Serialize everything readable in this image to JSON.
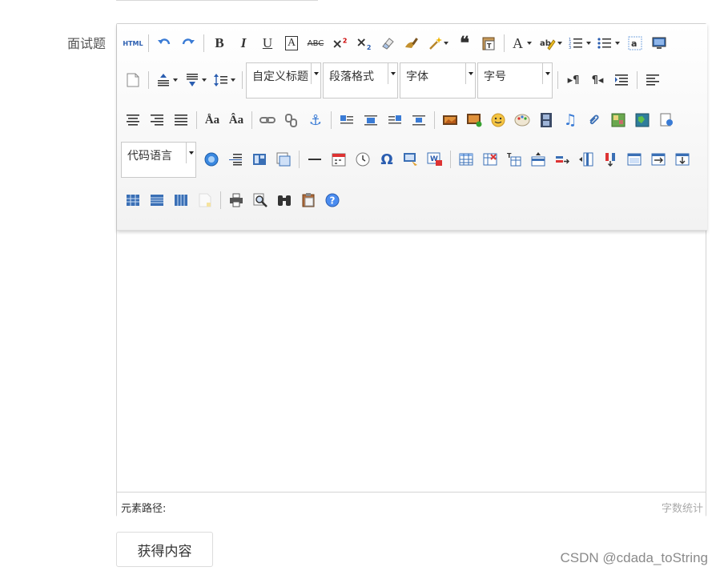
{
  "field": {
    "label": "面试题"
  },
  "toolbar": {
    "html_label": "HTML",
    "superscript_label": "2",
    "subscript_label": "2",
    "bold_label": "B",
    "italic_label": "I",
    "underline_label": "U",
    "fontborder_label": "A",
    "strike_label": "ABC",
    "forecolor_label": "A",
    "custom_heading": "自定义标题",
    "paragraph_format": "段落格式",
    "font_family": "字体",
    "font_size": "字号",
    "code_language": "代码语言",
    "omega_label": "Ω"
  },
  "statusbar": {
    "path_label": "元素路径:",
    "word_count_label": "字数统计"
  },
  "get_content_button": "获得内容",
  "watermark": "CSDN @cdada_toString",
  "colors": {
    "blue_icon": "#3a7bd5",
    "icon_dark": "#333333",
    "border": "#d4d4d4"
  }
}
